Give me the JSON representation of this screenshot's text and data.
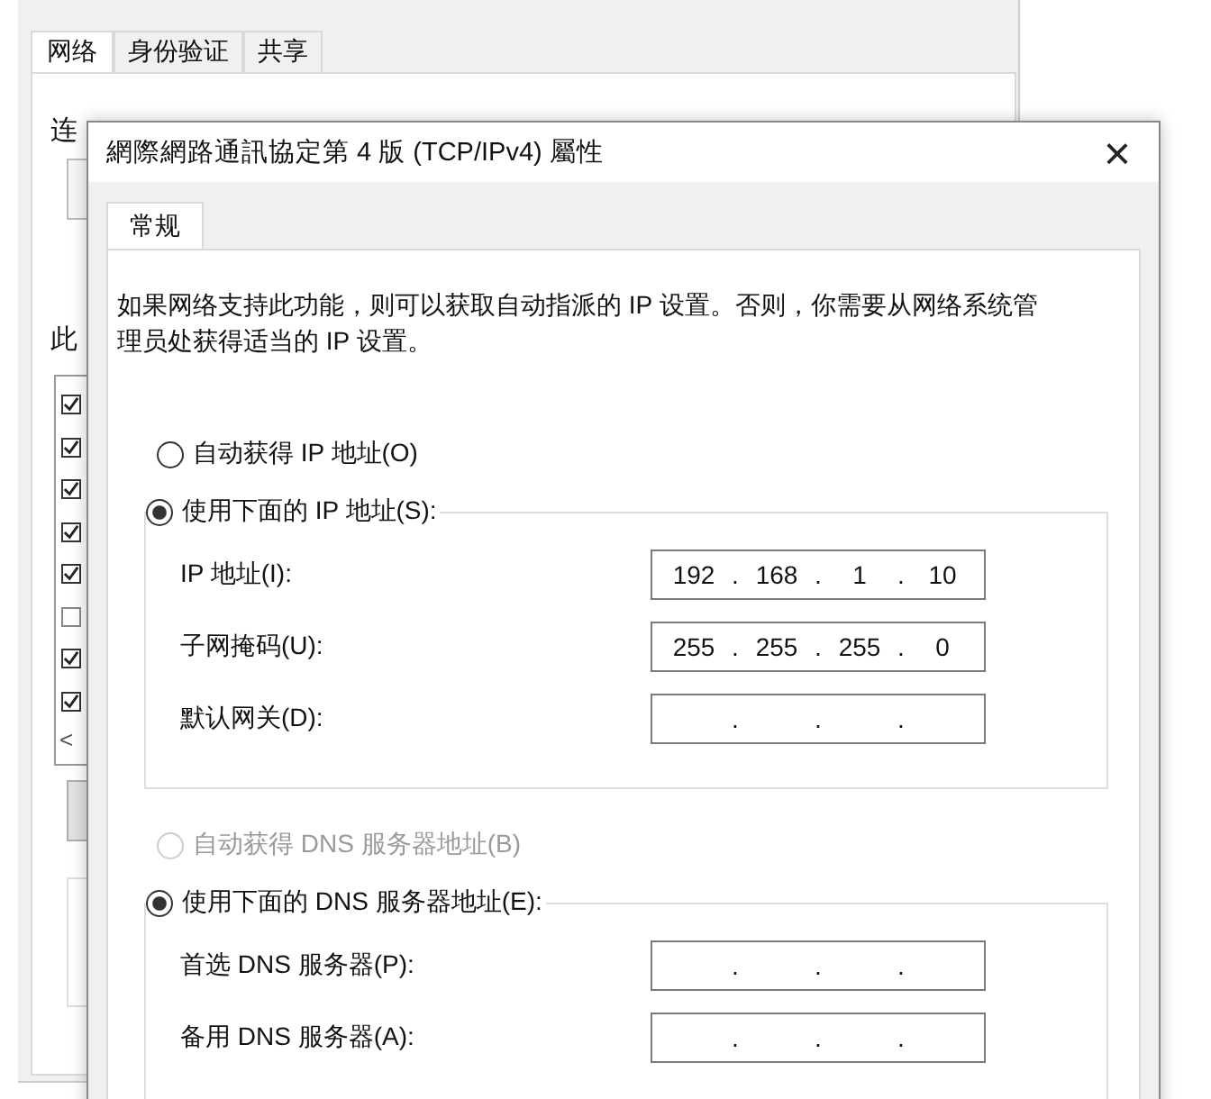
{
  "back_window": {
    "tabs": [
      {
        "label": "网络",
        "selected": true
      },
      {
        "label": "身份验证",
        "selected": false
      },
      {
        "label": "共享",
        "selected": false
      }
    ],
    "label_1": "连",
    "label_2": "此",
    "components": [
      {
        "checked": true
      },
      {
        "checked": true
      },
      {
        "checked": true
      },
      {
        "checked": true
      },
      {
        "checked": true
      },
      {
        "checked": false
      },
      {
        "checked": true
      },
      {
        "checked": true
      }
    ],
    "scroll_arrow": "<"
  },
  "dialog": {
    "title": "網際網路通訊協定第 4 版 (TCP/IPv4) 屬性",
    "close": "×",
    "tabs": [
      {
        "label": "常规",
        "selected": true
      }
    ],
    "description": "如果网络支持此功能，则可以获取自动指派的 IP 设置。否则，你需要从网络系统管理员处获得适当的 IP 设置。",
    "ip_mode": [
      {
        "label": "自动获得 IP 地址(O)",
        "selected": false,
        "disabled": false
      },
      {
        "label": "使用下面的 IP 地址(S):",
        "selected": true,
        "disabled": false
      }
    ],
    "ip_fields": [
      {
        "label": "IP 地址(I):",
        "octets": [
          "192",
          "168",
          "1",
          "10"
        ],
        "dots": [
          ".",
          ".",
          "."
        ]
      },
      {
        "label": "子网掩码(U):",
        "octets": [
          "255",
          "255",
          "255",
          "0"
        ],
        "dots": [
          ".",
          ".",
          "."
        ]
      },
      {
        "label": "默认网关(D):",
        "dots": [
          ".",
          ".",
          "."
        ]
      }
    ],
    "dns_mode": [
      {
        "label": "自动获得 DNS 服务器地址(B)",
        "selected": false,
        "disabled": true
      },
      {
        "label": "使用下面的 DNS 服务器地址(E):",
        "selected": true,
        "disabled": false
      }
    ],
    "dns_fields": [
      {
        "label": "首选 DNS 服务器(P):",
        "dots": [
          ".",
          ".",
          "."
        ]
      },
      {
        "label": "备用 DNS 服务器(A):",
        "dots": [
          ".",
          ".",
          "."
        ]
      }
    ]
  }
}
